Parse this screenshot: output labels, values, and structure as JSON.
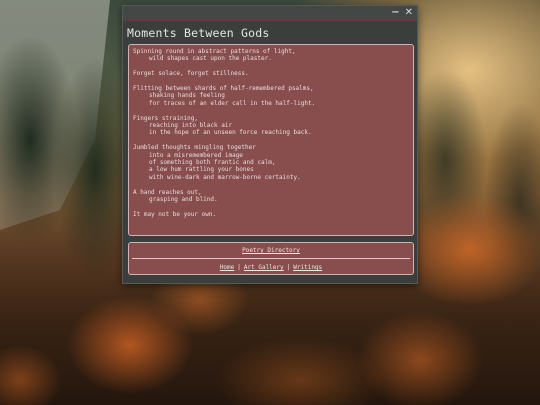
{
  "window": {
    "title": "Moments Between Gods",
    "controls": {
      "minimize": "−",
      "close": "✕"
    }
  },
  "poem": {
    "stanzas": [
      {
        "lines": [
          {
            "text": "Spinning round in abstract patterns of light,",
            "indent": 0
          },
          {
            "text": "wild shapes cast upon the plaster.",
            "indent": 1
          }
        ]
      },
      {
        "lines": [
          {
            "text": "Forget solace, forget stillness.",
            "indent": 0
          }
        ]
      },
      {
        "lines": [
          {
            "text": "Flitting between shards of half-remembered psalms,",
            "indent": 0
          },
          {
            "text": "shaking hands feeling",
            "indent": 1
          },
          {
            "text": "for traces of an elder call in the half-light.",
            "indent": 1
          }
        ]
      },
      {
        "lines": [
          {
            "text": "Fingers straining,",
            "indent": 0
          },
          {
            "text": "reaching into black air",
            "indent": 1
          },
          {
            "text": "in the hope of an unseen force reaching back.",
            "indent": 1
          }
        ]
      },
      {
        "lines": [
          {
            "text": "Jumbled thoughts mingling together",
            "indent": 0
          },
          {
            "text": "into a misremembered image",
            "indent": 1
          },
          {
            "text": "of something both frantic and calm,",
            "indent": 1
          },
          {
            "text": "a low hum rattling your bones",
            "indent": 1
          },
          {
            "text": "with wine-dark and marrow-borne certainty.",
            "indent": 1
          }
        ]
      },
      {
        "lines": [
          {
            "text": "A hand reaches out,",
            "indent": 0
          },
          {
            "text": "grasping and blind.",
            "indent": 1
          }
        ]
      },
      {
        "lines": [
          {
            "text": "It may not be your own.",
            "indent": 0
          }
        ]
      }
    ]
  },
  "links": {
    "directory": "Poetry Directory",
    "nav": [
      {
        "label": "Home",
        "name": "home-link"
      },
      {
        "label": "Art Gallery",
        "name": "art-gallery-link"
      },
      {
        "label": "Writings",
        "name": "writings-link"
      }
    ],
    "separator": "|"
  },
  "colors": {
    "panel": "#884e4e",
    "panel_border": "#cfb3b3",
    "window_bg": "#3a3f3d",
    "text": "#e8dcdc"
  }
}
